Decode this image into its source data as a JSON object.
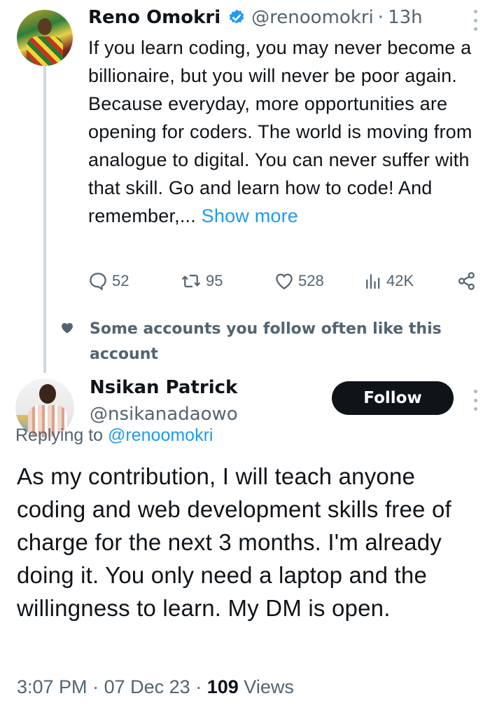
{
  "parent_tweet": {
    "author_name": "Reno Omokri",
    "handle": "@renoomokri",
    "separator": "·",
    "time_ago": "13h",
    "text": "If you learn coding, you may never become a billionaire, but you will never be poor again. Because everyday, more opportunities are opening for coders. The world is moving from analogue to digital. You can never suffer with that skill. Go and learn how to code! And remember,...",
    "show_more": "Show more",
    "actions": {
      "replies": "52",
      "reposts": "95",
      "likes": "528",
      "views": "42K"
    },
    "icons": {
      "verified": "verified-badge-icon",
      "more": "more-vertical-icon",
      "reply": "speech-bubble-icon",
      "repost": "repost-icon",
      "like": "heart-icon",
      "views": "bar-chart-icon",
      "share": "share-icon"
    }
  },
  "social_context": {
    "text": "Some accounts you follow often like this account",
    "icon": "heart-icon"
  },
  "reply_tweet": {
    "author_name": "Nsikan Patrick",
    "handle": "@nsikanadaowo",
    "follow_label": "Follow",
    "replying_prefix": "Replying to",
    "replying_to": "@renoomokri",
    "text": "As my contribution, I will teach anyone coding and web development skills free of charge for the next 3 months. I'm already doing it. You only need a laptop and the willingness to learn. My DM is open.",
    "time": "3:07 PM",
    "date": "07 Dec 23",
    "separator": "·",
    "views_count": "109",
    "views_label": "Views"
  },
  "colors": {
    "text": "#0f1419",
    "secondary": "#536471",
    "accent": "#1d9bf0",
    "verified": "#1d9bf0",
    "thread_line": "#cfd9de",
    "follow_bg": "#0f1419"
  }
}
